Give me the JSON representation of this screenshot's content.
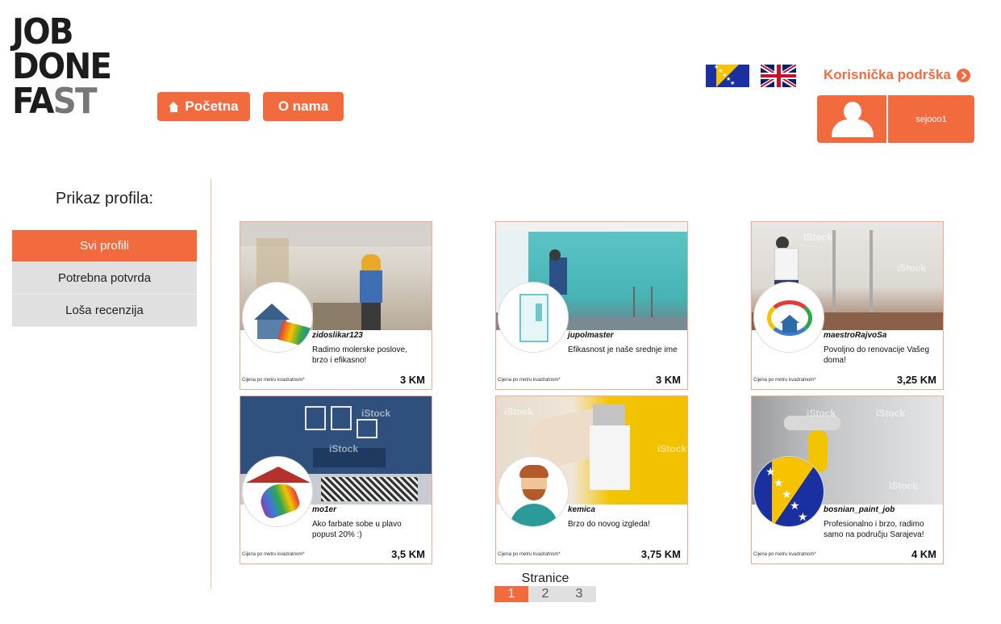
{
  "logo": {
    "line1": "JOB",
    "line2": "DONE",
    "line3_a": "FA",
    "line3_b": "ST"
  },
  "nav": {
    "home_label": "Početna",
    "about_label": "O nama"
  },
  "header": {
    "support_label": "Korisnička podrška",
    "username": "sejooo1"
  },
  "sidebar": {
    "title": "Prikaz profila:",
    "items": [
      {
        "label": "Svi profili",
        "active": true
      },
      {
        "label": "Potrebna potvrda",
        "active": false
      },
      {
        "label": "Loša recenzija",
        "active": false
      }
    ]
  },
  "cards": [
    {
      "username": "zidoslikar123",
      "description": "Radimo molerske poslove, brzo i efikasno!",
      "price_label": "Cijena po metru kvadratnom*",
      "price": "3 KM"
    },
    {
      "username": "jupolmaster",
      "description": "Efikasnost je naše srednje ime",
      "price_label": "Cijena po metru kvadratnom*",
      "price": "3 KM"
    },
    {
      "username": "maestroRajvoSa",
      "description": "Povoljno do renovacije Vašeg doma!",
      "price_label": "Cijena po metru kvadratnom*",
      "price": "3,25 KM"
    },
    {
      "username": "mo1er",
      "description": "Ako farbate sobe u plavo popust 20% :)",
      "price_label": "Cijena po metru kvadratnom*",
      "price": "3,5 KM"
    },
    {
      "username": "kemica",
      "description": "Brzo do novog izgleda!",
      "price_label": "Cijena po metru kvadratnom*",
      "price": "3,75 KM"
    },
    {
      "username": "bosnian_paint_job",
      "description": "Profesionalno i brzo, radimo samo na području Sarajeva!",
      "price_label": "Cijena po metru kvadratnom*",
      "price": "4 KM"
    }
  ],
  "watermark": "iStock",
  "pagination": {
    "title": "Stranice",
    "pages": [
      "1",
      "2",
      "3"
    ],
    "current": "1"
  },
  "colors": {
    "accent": "#f26b3f",
    "sidebar_bg": "#e0e0e0"
  },
  "icons": [
    "home-icon",
    "bosnia-flag-icon",
    "uk-flag-icon",
    "chevron-right-circle-icon",
    "user-avatar-icon"
  ]
}
